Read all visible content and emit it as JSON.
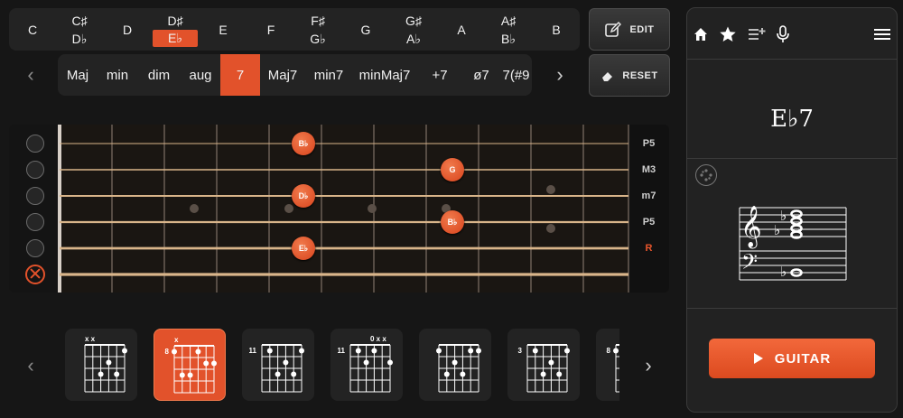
{
  "roots": [
    {
      "top": "C",
      "bottom": "",
      "selected": false
    },
    {
      "top": "C♯",
      "bottom": "D♭",
      "selected": false
    },
    {
      "top": "D",
      "bottom": "",
      "selected": false
    },
    {
      "top": "D♯",
      "bottom": "E♭",
      "selected": true
    },
    {
      "top": "E",
      "bottom": "",
      "selected": false
    },
    {
      "top": "F",
      "bottom": "",
      "selected": false
    },
    {
      "top": "F♯",
      "bottom": "G♭",
      "selected": false
    },
    {
      "top": "G",
      "bottom": "",
      "selected": false
    },
    {
      "top": "G♯",
      "bottom": "A♭",
      "selected": false
    },
    {
      "top": "A",
      "bottom": "",
      "selected": false
    },
    {
      "top": "A♯",
      "bottom": "B♭",
      "selected": false
    },
    {
      "top": "B",
      "bottom": "",
      "selected": false
    }
  ],
  "qualities": [
    "Maj",
    "min",
    "dim",
    "aug",
    "7",
    "Maj7",
    "min7",
    "minMaj7",
    "+7",
    "ø7",
    "7(#9"
  ],
  "selected_quality": "7",
  "buttons": {
    "edit": "EDIT",
    "reset": "RESET"
  },
  "intervals": [
    "P5",
    "M3",
    "m7",
    "P5",
    "R"
  ],
  "notes": [
    {
      "label": "B♭",
      "string": 1,
      "fret": 5
    },
    {
      "label": "G",
      "string": 2,
      "fret": 8
    },
    {
      "label": "D♭",
      "string": 3,
      "fret": 5
    },
    {
      "label": "B♭",
      "string": 4,
      "fret": 8
    },
    {
      "label": "E♭",
      "string": 5,
      "fret": 5
    }
  ],
  "voicings": [
    {
      "start": "",
      "top": "x x",
      "selected": false
    },
    {
      "start": "8",
      "top": "x",
      "selected": true
    },
    {
      "start": "11",
      "top": "",
      "selected": false
    },
    {
      "start": "11",
      "top": "0 x x",
      "selected": false
    },
    {
      "start": "",
      "top": "",
      "selected": false
    },
    {
      "start": "3",
      "top": "",
      "selected": false
    },
    {
      "start": "8",
      "top": "",
      "selected": false
    }
  ],
  "panel": {
    "chord_name": "E♭7",
    "play_label": "GUITAR",
    "icons": [
      "home-icon",
      "star-icon",
      "playlist-add-icon",
      "microphone-icon",
      "menu-icon"
    ]
  },
  "colors": {
    "accent": "#e2522b"
  }
}
